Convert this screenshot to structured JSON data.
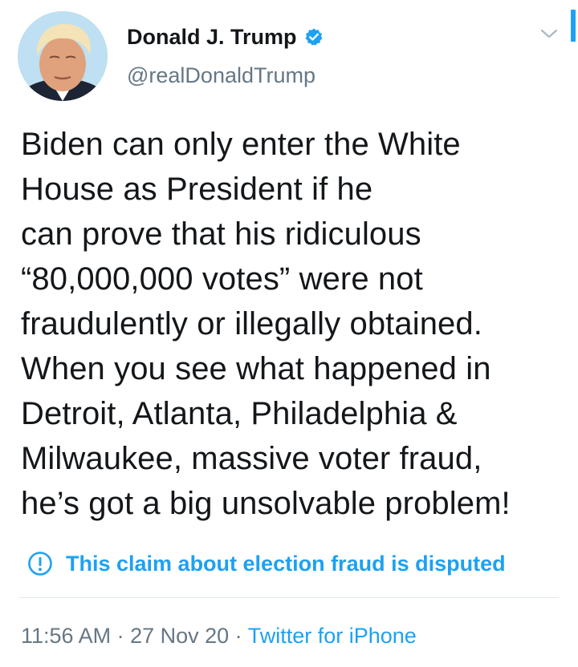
{
  "author": {
    "display_name": "Donald J. Trump",
    "handle": "@realDonaldTrump",
    "avatar_icon": "profile-photo",
    "verified_icon": "verified-badge-icon"
  },
  "tweet": {
    "text": "Biden can only enter the White\nHouse as President if he\ncan prove that his ridiculous\n“80,000,000 votes” were not\nfraudulently or illegally obtained.\nWhen you see what happened in\nDetroit, Atlanta, Philadelphia &\nMilwaukee, massive voter fraud,\nhe’s got a big unsolvable problem!"
  },
  "notice": {
    "icon": "exclamation-circle-icon",
    "text": "This claim about election fraud is disputed"
  },
  "meta": {
    "time": "11:56 AM",
    "sep1": " · ",
    "date": "27 Nov 20",
    "sep2": " · ",
    "source": "Twitter for iPhone"
  },
  "colors": {
    "accent": "#1da1f2",
    "text": "#14171a",
    "secondary": "#657786",
    "divider": "#e1e8ed"
  }
}
